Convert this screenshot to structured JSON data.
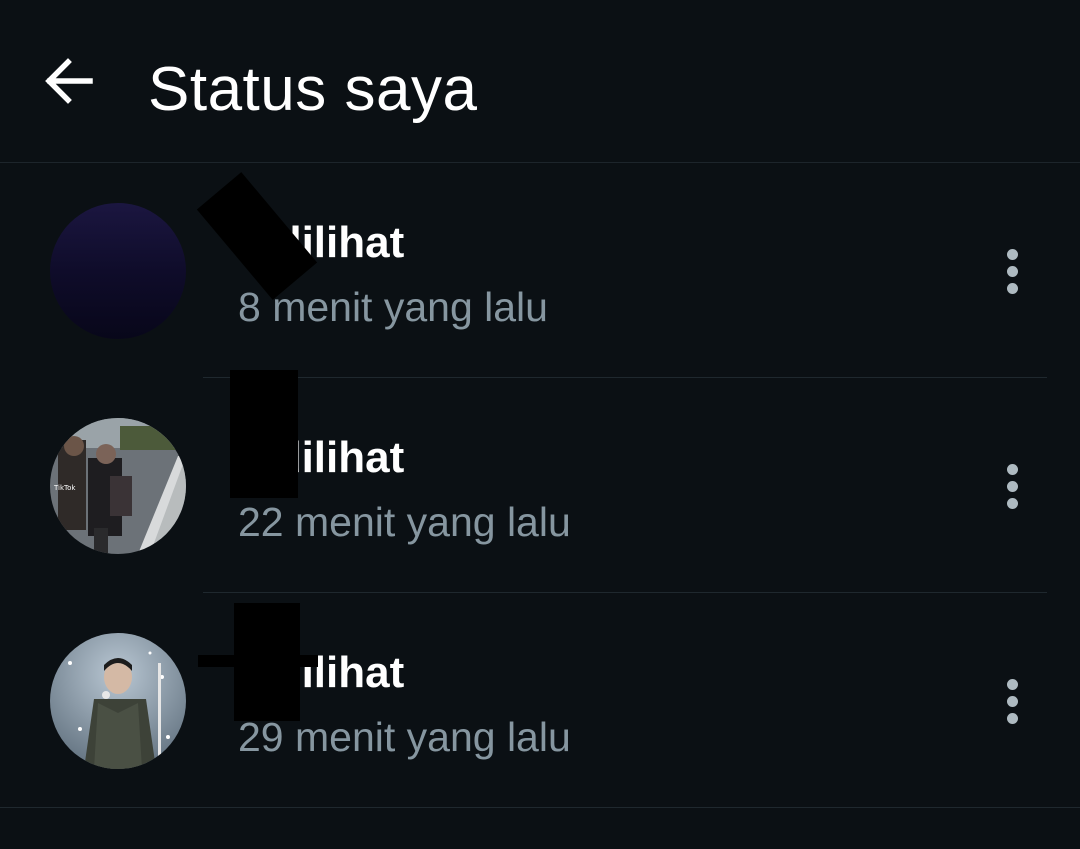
{
  "app_bar": {
    "back_icon": "arrow-left-icon",
    "title": "Status saya"
  },
  "statuses": [
    {
      "views": "x dilihat",
      "time": "8 menit yang lalu",
      "thumbnail": "dark-gradient-thumbnail",
      "menu_icon": "more-vertical-icon"
    },
    {
      "views": "x dilihat",
      "time": "22 menit yang lalu",
      "thumbnail": "video-street-thumbnail",
      "menu_icon": "more-vertical-icon"
    },
    {
      "views": "x dilihat",
      "time": "29 menit yang lalu",
      "thumbnail": "performer-stage-thumbnail",
      "menu_icon": "more-vertical-icon"
    }
  ],
  "colors": {
    "background": "#0b1014",
    "title": "#ffffff",
    "secondary_text": "#8696a0",
    "icon": "#aebac1",
    "divider": "#1f282e"
  }
}
